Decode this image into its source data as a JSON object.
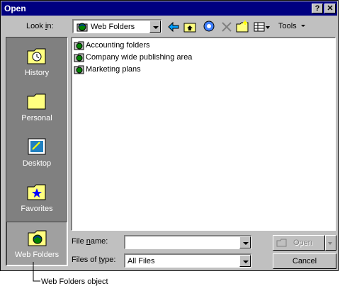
{
  "window": {
    "title": "Open",
    "help_label": "?",
    "close_label": "✕"
  },
  "toolbar": {
    "look_in_label": "Look in:",
    "look_in_value": "Web Folders",
    "tools_label": "Tools"
  },
  "places": [
    {
      "label": "History",
      "icon": "history-icon"
    },
    {
      "label": "Personal",
      "icon": "personal-folder-icon"
    },
    {
      "label": "Desktop",
      "icon": "desktop-icon"
    },
    {
      "label": "Favorites",
      "icon": "favorites-icon"
    },
    {
      "label": "Web Folders",
      "icon": "web-folders-icon"
    }
  ],
  "files": [
    {
      "name": "Accounting folders"
    },
    {
      "name": "Company wide publishing area"
    },
    {
      "name": "Marketing plans"
    }
  ],
  "fields": {
    "file_name_label": "File name:",
    "file_name_value": "",
    "files_of_type_label": "Files of type:",
    "files_of_type_value": "All Files"
  },
  "buttons": {
    "open_label": "Open",
    "cancel_label": "Cancel"
  },
  "callout": "Web Folders object",
  "colors": {
    "title_bar": "#000080",
    "dialog_bg": "#c0c0c0",
    "places_bg": "#808080"
  }
}
